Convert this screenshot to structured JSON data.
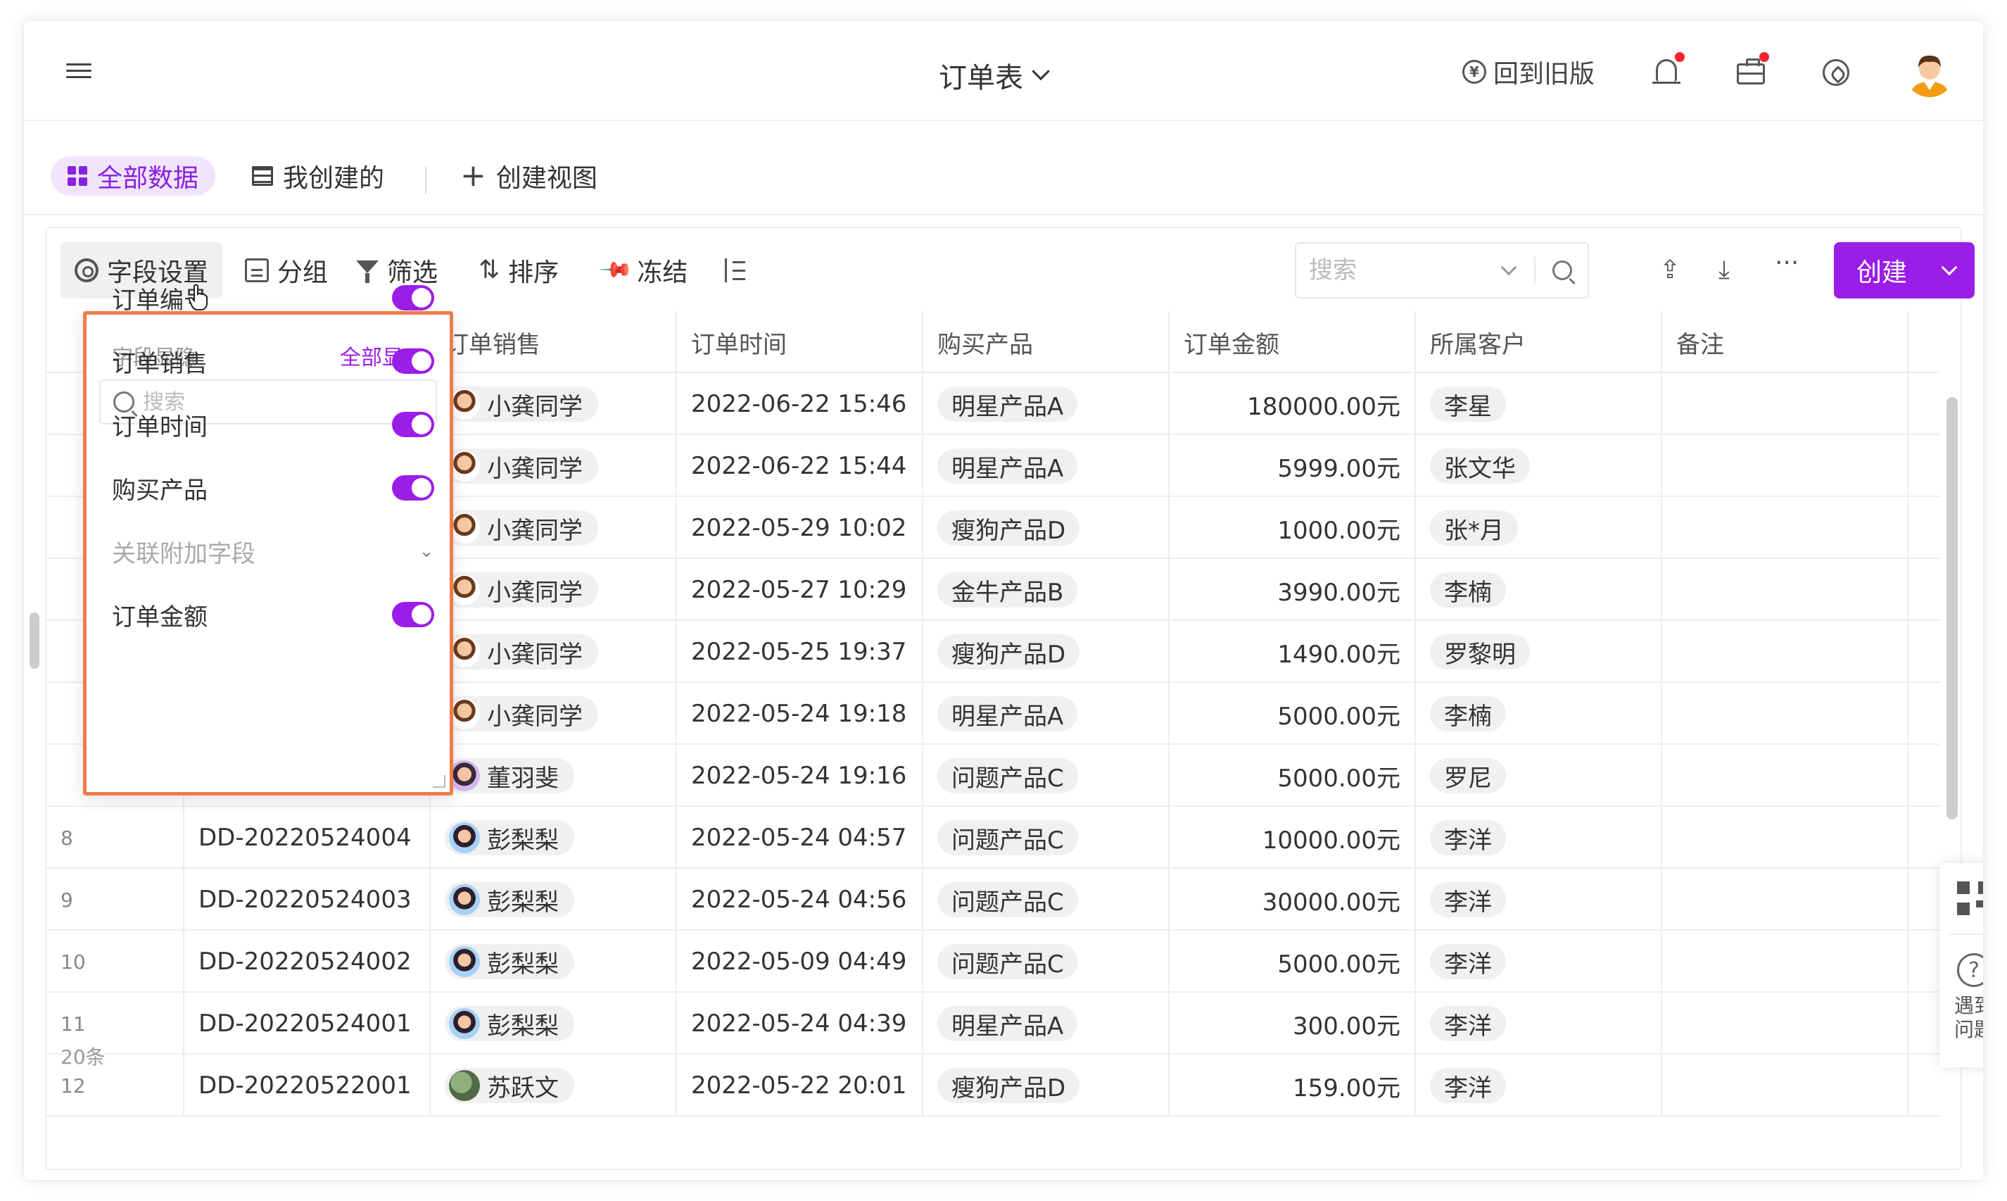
{
  "header": {
    "title": "订单表",
    "back_old": "回到旧版",
    "back_old_icon": "¥"
  },
  "views": {
    "all": "全部数据",
    "mine": "我创建的",
    "create": "创建视图"
  },
  "toolbar": {
    "field_settings": "字段设置",
    "group": "分组",
    "filter": "筛选",
    "sort": "排序",
    "freeze": "冻结",
    "search_placeholder": "搜索",
    "create": "创建",
    "upload_icon": "upload-icon",
    "download_icon": "download-icon",
    "more": "···"
  },
  "field_panel": {
    "title": "字段显隐",
    "show_all": "全部显示",
    "search_placeholder": "搜索",
    "fields": [
      {
        "label": "订单编号",
        "visible": true
      },
      {
        "label": "订单销售",
        "visible": true
      },
      {
        "label": "订单时间",
        "visible": true
      },
      {
        "label": "购买产品",
        "visible": true
      },
      {
        "label": "关联附加字段",
        "expandable": true
      },
      {
        "label": "订单金额",
        "visible": true
      }
    ]
  },
  "table": {
    "columns": [
      "",
      "",
      "订单销售",
      "订单时间",
      "购买产品",
      "订单金额",
      "所属客户",
      "备注"
    ],
    "rows": [
      {
        "no": "",
        "id": "",
        "sales": "小龚同学",
        "time": "2022-06-22 15:46",
        "product": "明星产品A",
        "amount": "180000.00元",
        "customer": "李星"
      },
      {
        "no": "",
        "id": "",
        "sales": "小龚同学",
        "time": "2022-06-22 15:44",
        "product": "明星产品A",
        "amount": "5999.00元",
        "customer": "张文华"
      },
      {
        "no": "",
        "id": "",
        "sales": "小龚同学",
        "time": "2022-05-29 10:02",
        "product": "瘦狗产品D",
        "amount": "1000.00元",
        "customer": "张*月"
      },
      {
        "no": "",
        "id": "",
        "sales": "小龚同学",
        "time": "2022-05-27 10:29",
        "product": "金牛产品B",
        "amount": "3990.00元",
        "customer": "李楠"
      },
      {
        "no": "",
        "id": "",
        "sales": "小龚同学",
        "time": "2022-05-25 19:37",
        "product": "瘦狗产品D",
        "amount": "1490.00元",
        "customer": "罗黎明"
      },
      {
        "no": "",
        "id": "",
        "sales": "小龚同学",
        "time": "2022-05-24 19:18",
        "product": "明星产品A",
        "amount": "5000.00元",
        "customer": "李楠"
      },
      {
        "no": "",
        "id": "",
        "sales": "董羽斐",
        "time": "2022-05-24 19:16",
        "product": "问题产品C",
        "amount": "5000.00元",
        "customer": "罗尼"
      },
      {
        "no": "8",
        "id": "DD-20220524004",
        "sales": "彭梨梨",
        "time": "2022-05-24 04:57",
        "product": "问题产品C",
        "amount": "10000.00元",
        "customer": "李洋"
      },
      {
        "no": "9",
        "id": "DD-20220524003",
        "sales": "彭梨梨",
        "time": "2022-05-24 04:56",
        "product": "问题产品C",
        "amount": "30000.00元",
        "customer": "李洋"
      },
      {
        "no": "10",
        "id": "DD-20220524002",
        "sales": "彭梨梨",
        "time": "2022-05-09 04:49",
        "product": "问题产品C",
        "amount": "5000.00元",
        "customer": "李洋"
      },
      {
        "no": "11",
        "id": "DD-20220524001",
        "sales": "彭梨梨",
        "time": "2022-05-24 04:39",
        "product": "明星产品A",
        "amount": "300.00元",
        "customer": "李洋"
      },
      {
        "no": "12",
        "id": "DD-20220522001",
        "sales": "苏跃文",
        "time": "2022-05-22 20:01",
        "product": "瘦狗产品D",
        "amount": "159.00元",
        "customer": "李洋"
      }
    ],
    "footer_count": "20条"
  },
  "side_panel": {
    "help_label": "遇到问题",
    "help_icon": "?"
  },
  "colors": {
    "accent": "#9b1ee8",
    "highlight_border": "#f07c48"
  }
}
